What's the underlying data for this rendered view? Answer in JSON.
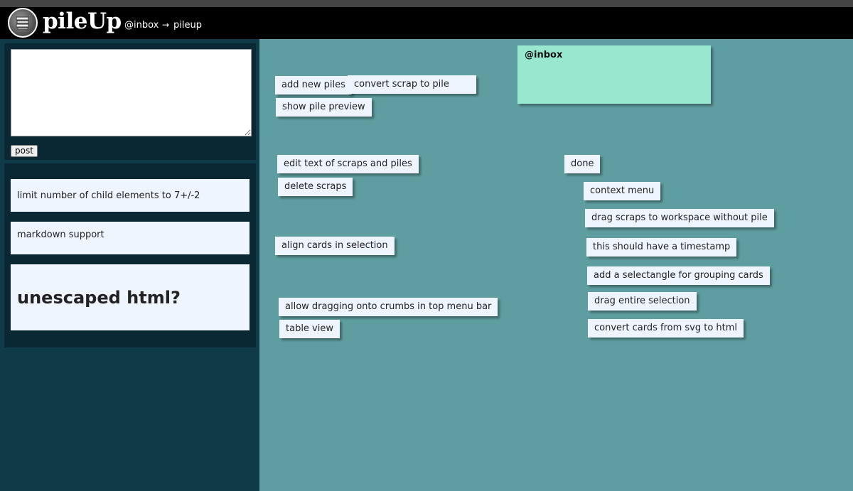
{
  "app": {
    "name": "pileUp"
  },
  "breadcrumbs": [
    {
      "label": "@inbox"
    },
    {
      "label": "pileup"
    }
  ],
  "breadcrumb_separator": "→",
  "post_form": {
    "textarea_value": "",
    "button_label": "post"
  },
  "sidebar_cards": [
    {
      "text": "limit number of child elements to 7+/-2"
    },
    {
      "text": "markdown support"
    },
    {
      "text": "unescaped html?"
    }
  ],
  "pile": {
    "label": "@inbox"
  },
  "workspace_cards": [
    {
      "text": "add new piles"
    },
    {
      "text": "convert scrap to pile"
    },
    {
      "text": "show pile preview"
    },
    {
      "text": "edit text of scraps and piles"
    },
    {
      "text": "delete scraps"
    },
    {
      "text": "align cards in selection"
    },
    {
      "text": "allow dragging onto crumbs in top menu bar"
    },
    {
      "text": "table view"
    },
    {
      "text": "done"
    },
    {
      "text": "context menu"
    },
    {
      "text": "drag scraps to workspace without pile"
    },
    {
      "text": "this should have a timestamp"
    },
    {
      "text": "add a selectangle for grouping cards"
    },
    {
      "text": "drag entire selection"
    },
    {
      "text": "convert cards from svg to html"
    }
  ],
  "colors": {
    "topbar": "#000000",
    "sidebar": "#0f3a48",
    "workspace": "#5f9ea0",
    "card": "#eef5ff",
    "pile": "#98e8d0"
  }
}
